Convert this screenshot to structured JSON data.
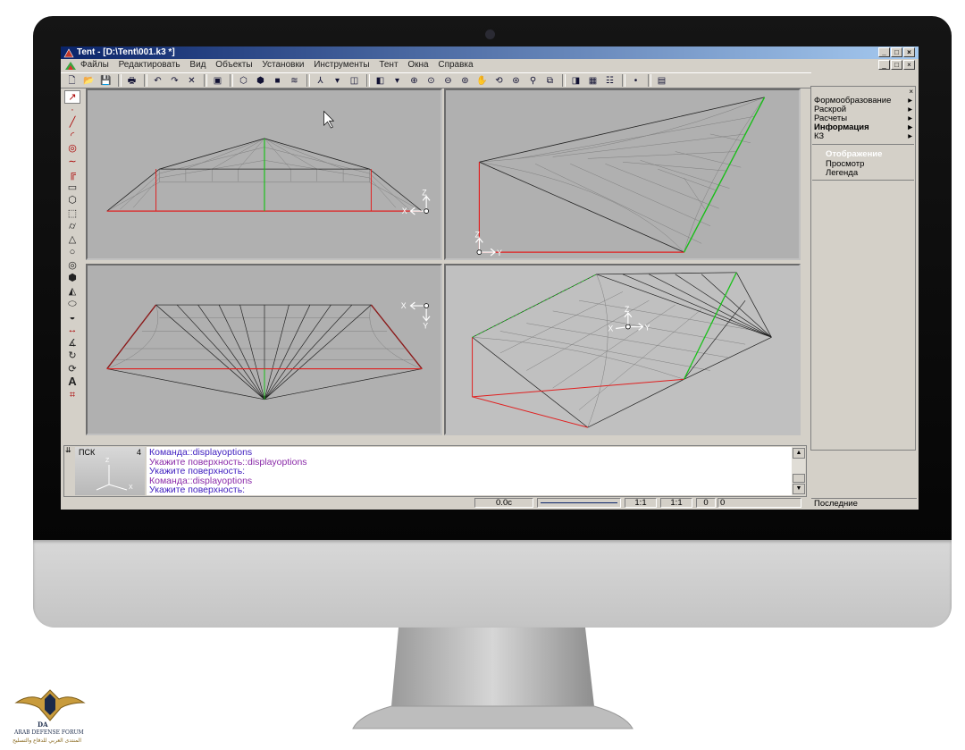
{
  "window": {
    "title": "Tent - [D:\\Tent\\001.k3 *]"
  },
  "window_buttons": {
    "minimize": "_",
    "maximize": "□",
    "close": "×"
  },
  "menu": [
    "Файлы",
    "Редактировать",
    "Вид",
    "Объекты",
    "Установки",
    "Инструменты",
    "Тент",
    "Окна",
    "Справка"
  ],
  "viewport_axes": {
    "front": {
      "up": "Z",
      "side": "X"
    },
    "side": {
      "up": "Z",
      "side": "Y"
    },
    "top": {
      "side": "X",
      "down": "Y"
    },
    "iso": {
      "up": "Z",
      "side": "Y",
      "left": "X"
    }
  },
  "right_panel": {
    "menu": [
      {
        "label": "Формообразование",
        "arrow": "▸"
      },
      {
        "label": "Раскрой",
        "arrow": "▸"
      },
      {
        "label": "Расчеты",
        "arrow": "▸"
      },
      {
        "label": "Информация",
        "arrow": "▸"
      },
      {
        "label": "КЗ",
        "arrow": "▸"
      }
    ],
    "submenu": [
      "Отображение",
      "Просмотр",
      "Легенда"
    ],
    "footer": "Последние"
  },
  "command": {
    "csys_label": "ПСК",
    "csys_number": "4",
    "axis_labels": {
      "z": "Z",
      "x": "X"
    },
    "log": [
      "Команда::displayoptions",
      "Укажите поверхность::displayoptions",
      "Укажите поверхность:",
      "Команда::displayoptions",
      "Укажите поверхность:"
    ]
  },
  "status": {
    "time": "0.0c",
    "scale1": "1:1",
    "scale2": "1:1",
    "v1": "0",
    "v2": "0"
  },
  "logo": {
    "initials": "DA",
    "name": "ARAB DEFENSE FORUM",
    "arabic": "المنتدى العربي للدفاع والتسليح"
  },
  "colors": {
    "title_start": "#0a246a",
    "title_end": "#a6caf0",
    "mesh": "#7e7e7e",
    "edge_red": "#e02020",
    "mast_green": "#18c018",
    "log_text": "#4020c0"
  }
}
